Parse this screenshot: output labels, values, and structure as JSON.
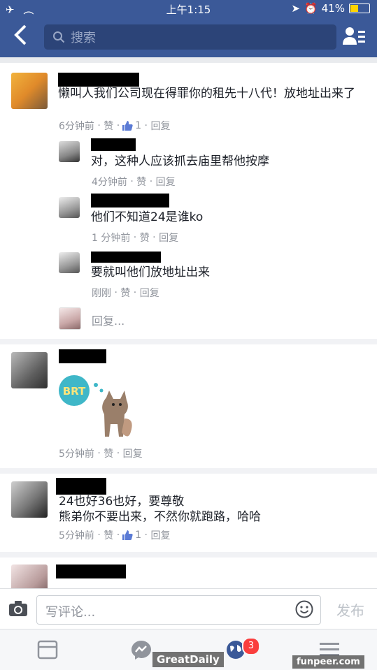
{
  "status_bar": {
    "time": "上午1:15",
    "battery": "41%"
  },
  "nav": {
    "search_placeholder": "搜索"
  },
  "comments": [
    {
      "text": "懒叫人我们公司现在得罪你的租先十八代！放地址出来了",
      "time": "6分钟前",
      "like": "赞",
      "like_count": "1",
      "reply": "回复",
      "replies": [
        {
          "text": "对，这种人应该抓去庙里帮他按摩",
          "time": "4分钟前",
          "like": "赞",
          "reply": "回复"
        },
        {
          "text": "他们不知道24是谁ko",
          "time": "1 分钟前",
          "like": "赞",
          "reply": "回复"
        },
        {
          "text": "要就叫他们放地址出来",
          "time": "刚刚",
          "like": "赞",
          "reply": "回复"
        }
      ],
      "reply_placeholder": "回复..."
    },
    {
      "sticker_text": "BRT",
      "time": "5分钟前",
      "like": "赞",
      "reply": "回复"
    },
    {
      "text": "24也好36也好，要尊敬\n熊弟你不要出来，不然你就跑路，哈哈",
      "time": "5分钟前",
      "like": "赞",
      "like_count": "1",
      "reply": "回复"
    }
  ],
  "composer": {
    "placeholder": "写评论...",
    "post_label": "发布"
  },
  "tabbar": {
    "notifications_badge": "3"
  },
  "watermarks": {
    "left": "GreatDaily",
    "right": "funpeer.com"
  },
  "colors": {
    "brand": "#3b5998",
    "muted": "#90949c",
    "badge": "#fa3e3e"
  }
}
